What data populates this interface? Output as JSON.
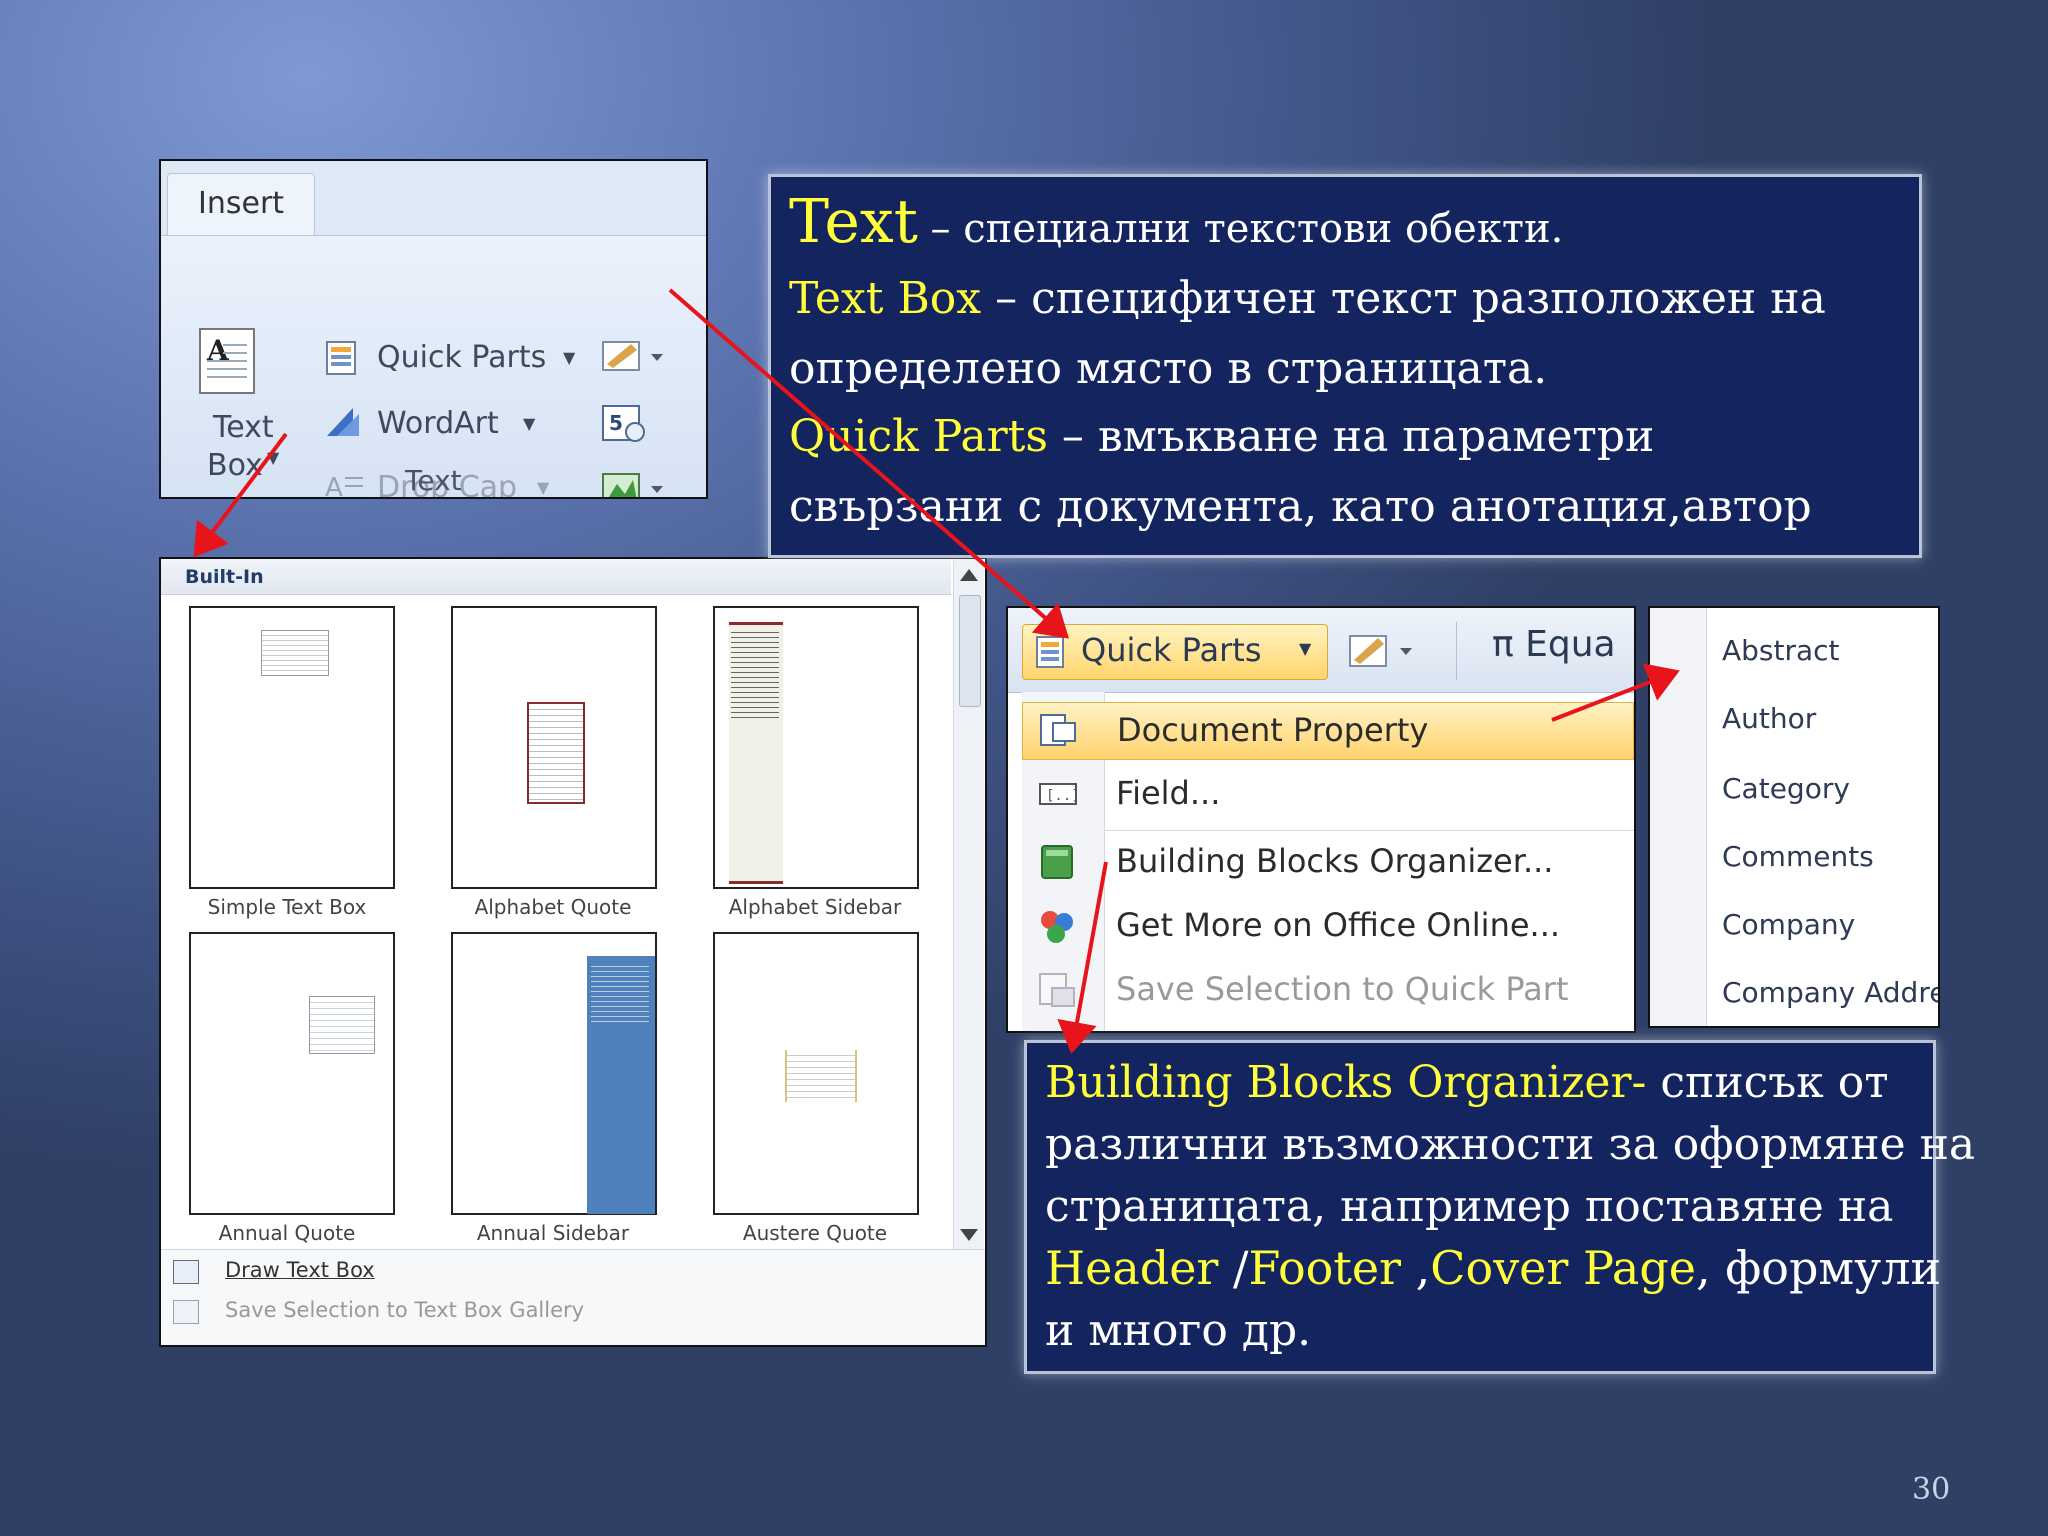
{
  "ribbon": {
    "tab": "Insert",
    "text_box_label_1": "Text",
    "text_box_label_2": "Box",
    "quick_parts": "Quick Parts",
    "wordart": "WordArt",
    "drop_cap": "Drop Cap",
    "group_label": "Text"
  },
  "gallery": {
    "header": "Built-In",
    "items": [
      "Simple Text Box",
      "Alphabet Quote",
      "Alphabet Sidebar",
      "Annual Quote",
      "Annual Sidebar",
      "Austere Quote"
    ],
    "footer_draw": "Draw Text Box",
    "footer_save": "Save Selection to Text Box Gallery"
  },
  "panel_top": {
    "l1_key": "Text",
    "l1_rest": " – специални  текстови обекти.",
    "l2_key": "Text Box",
    "l2_rest": " – специфичен текст разположен на",
    "l3": "определено място  в страницата.",
    "l4_key": "Quick Parts",
    "l4_rest": " – вмъкване на параметри",
    "l5": "свързани с документа, като анотация,автор"
  },
  "quick_parts_menu": {
    "button": "Quick Parts",
    "equation": "π Equa",
    "items": [
      {
        "label": "Document Property",
        "highlighted": true,
        "disabled": false
      },
      {
        "label": "Field...",
        "highlighted": false,
        "disabled": false
      },
      {
        "label": "Building Blocks Organizer...",
        "highlighted": false,
        "disabled": false
      },
      {
        "label": "Get More on Office Online...",
        "highlighted": false,
        "disabled": false
      },
      {
        "label": "Save Selection to Quick Part",
        "highlighted": false,
        "disabled": true
      }
    ]
  },
  "doc_property_menu": {
    "items": [
      "Abstract",
      "Author",
      "Category",
      "Comments",
      "Company",
      "Company Address"
    ]
  },
  "panel_bottom": {
    "l1_key": "Building Blocks Organizer-",
    "l1_rest": " списък от",
    "l2": "различни възможности за оформяне на",
    "l3": "страницата, например поставяне на",
    "l4_k1": "Header",
    "l4_s1": " /",
    "l4_k2": "Footer",
    "l4_s2": " ,",
    "l4_k3": "Cover Page",
    "l4_rest": ", формули",
    "l5": "и много др."
  },
  "slide_number": "30",
  "colors": {
    "panel_bg": "#14245e",
    "highlight_text": "#ffff3a",
    "arrow": "#e8141b"
  }
}
